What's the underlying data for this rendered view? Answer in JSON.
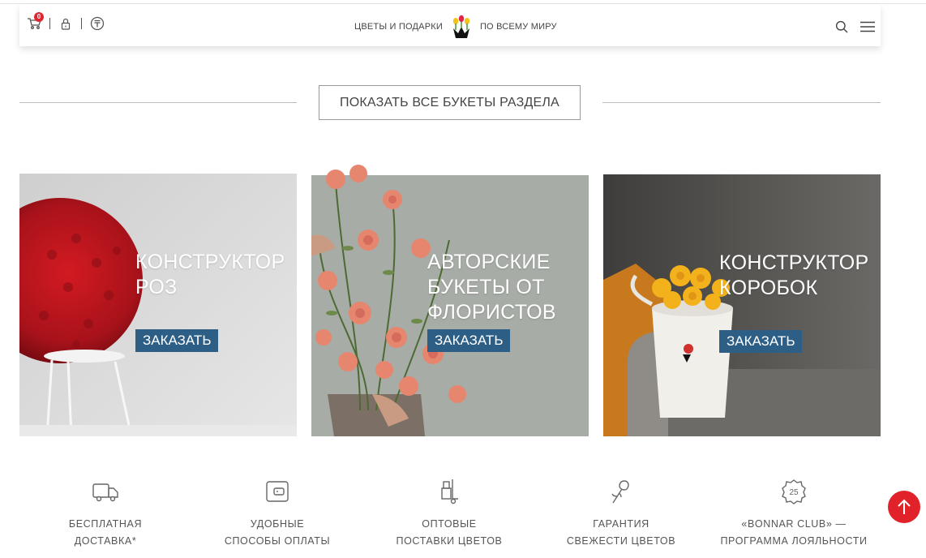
{
  "header": {
    "cart_count": "0",
    "brand_left": "ЦВЕТЫ И ПОДАРКИ",
    "brand_right": "ПО ВСЕМУ МИРУ",
    "icons": [
      "cart-icon",
      "lock-icon",
      "currency-icon",
      "search-icon",
      "menu-icon"
    ]
  },
  "show_all": {
    "label": "ПОКАЗАТЬ ВСЕ БУКЕТЫ РАЗДЕЛА"
  },
  "cards": [
    {
      "title": "КОНСТРУКТОР РОЗ",
      "button": "ЗАКАЗАТЬ"
    },
    {
      "title": "АВТОРСКИЕ БУКЕТЫ ОТ ФЛОРИСТОВ",
      "button": "ЗАКАЗАТЬ"
    },
    {
      "title": "КОНСТРУКТОР КОРОБОК",
      "button": "ЗАКАЗАТЬ"
    }
  ],
  "features": [
    {
      "icon": "truck-icon",
      "line1": "БЕСПЛАТНАЯ",
      "line2": "ДОСТАВКА*"
    },
    {
      "icon": "wallet-icon",
      "line1": "УДОБНЫЕ",
      "line2": "СПОСОБЫ ОПЛАТЫ"
    },
    {
      "icon": "hand-truck-icon",
      "line1": "ОПТОВЫЕ",
      "line2": "ПОСТАВКИ ЦВЕТОВ"
    },
    {
      "icon": "flower-icon",
      "line1": "ГАРАНТИЯ",
      "line2": "СВЕЖЕСТИ ЦВЕТОВ"
    },
    {
      "icon": "discount-badge-icon",
      "line1": "«BONNAR CLUB» —",
      "line2": "ПРОГРАММА ЛОЯЛЬНОСТИ"
    }
  ],
  "badge_text": "25",
  "colors": {
    "accent_button": "#2d5f86",
    "to_top": "#e1222a",
    "cart_badge": "#e0252f"
  }
}
